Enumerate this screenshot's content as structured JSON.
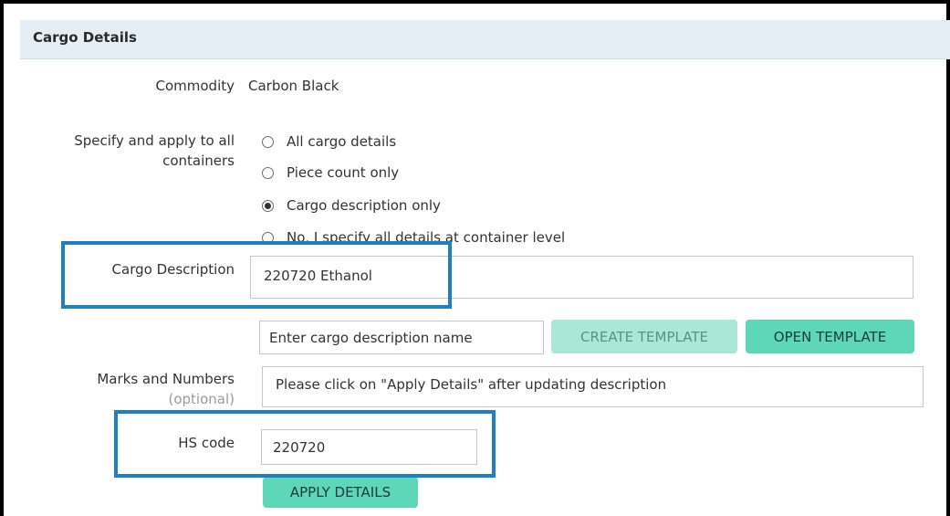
{
  "section": {
    "title": "Cargo Details"
  },
  "commodity": {
    "label": "Commodity",
    "value": "Carbon Black"
  },
  "apply_scope": {
    "label_line1": "Specify and apply to all",
    "label_line2": "containers",
    "options": [
      {
        "label": "All cargo details",
        "checked": false
      },
      {
        "label": "Piece count only",
        "checked": false
      },
      {
        "label": "Cargo description only",
        "checked": true
      },
      {
        "label": "No, I specify all details at container level",
        "checked": false
      }
    ]
  },
  "cargo_description": {
    "label": "Cargo Description",
    "value": "220720 Ethanol"
  },
  "template": {
    "name_placeholder": "Enter cargo description name",
    "create_label": "CREATE TEMPLATE",
    "open_label": "OPEN TEMPLATE"
  },
  "marks": {
    "label": "Marks and Numbers",
    "optional": "(optional)",
    "value": "Please click on \"Apply Details\" after updating description"
  },
  "hs_code": {
    "label": "HS code",
    "value": "220720"
  },
  "apply_button": {
    "label": "APPLY DETAILS"
  },
  "colors": {
    "header_bg": "#e6eef5",
    "highlight": "#1d7fc4",
    "button_primary": "#5ed6b8",
    "button_disabled": "#a9e8d6"
  }
}
